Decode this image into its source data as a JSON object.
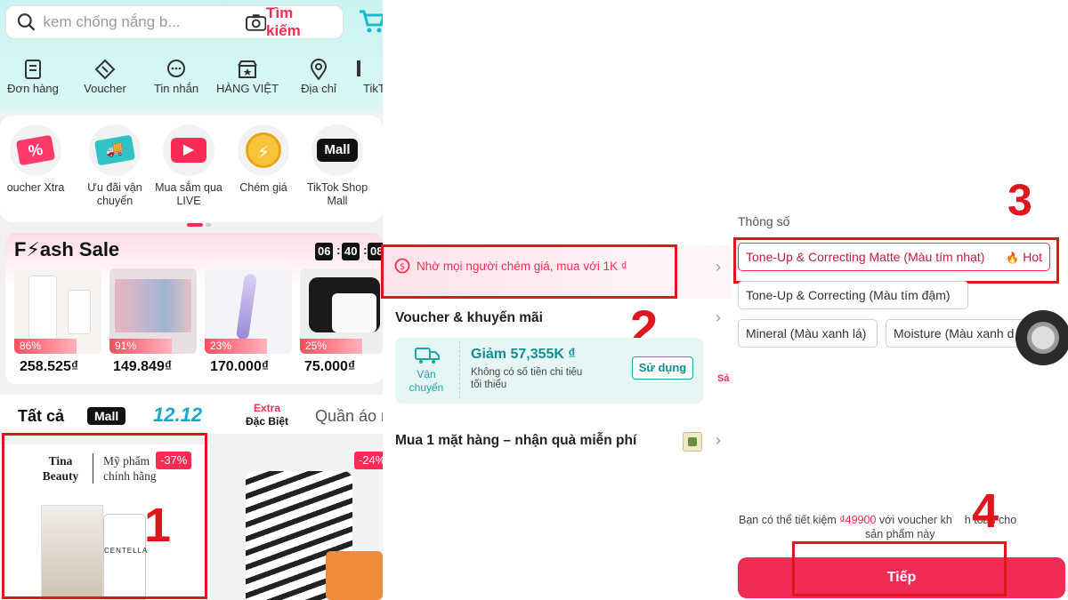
{
  "panel1": {
    "search": {
      "placeholder": "kem chống nắng b...",
      "button": "Tìm kiếm"
    },
    "quick_actions": [
      {
        "label": "Đơn hàng",
        "icon": "orders-icon"
      },
      {
        "label": "Voucher",
        "icon": "ticket-icon"
      },
      {
        "label": "Tin nhắn",
        "icon": "chat-icon"
      },
      {
        "label": "HÀNG VIỆT",
        "icon": "shop-icon"
      },
      {
        "label": "Địa chỉ",
        "icon": "location-icon"
      },
      {
        "label": "TikT",
        "icon": "tiktok-icon"
      }
    ],
    "features": [
      {
        "label": "oucher Xtra",
        "icon": "percent-coupon-icon",
        "glyph": "%"
      },
      {
        "label": "Ưu đãi vận chuyển",
        "icon": "truck-coupon-icon",
        "glyph": "🚚"
      },
      {
        "label": "Mua sắm qua LIVE",
        "icon": "live-video-icon",
        "glyph": "▶"
      },
      {
        "label": "Chém giá",
        "icon": "coin-icon",
        "glyph": "⚡"
      },
      {
        "label": "TikTok Shop Mall",
        "icon": "mall-icon",
        "glyph": "Mall"
      }
    ],
    "flash_sale": {
      "title": "F⚡ash Sale",
      "timer": [
        "06",
        "40",
        "08"
      ],
      "products": [
        {
          "percent": "86%",
          "price": "258.525₫",
          "fill": 0.86
        },
        {
          "percent": "91%",
          "price": "149.849₫",
          "fill": 0.91
        },
        {
          "percent": "23%",
          "price": "170.000₫",
          "fill": 0.23
        },
        {
          "percent": "25%",
          "price": "75.000₫",
          "fill": 0.25
        }
      ]
    },
    "tabs": {
      "all": "Tất cả",
      "mall": "Mall",
      "sale": "12.12",
      "extra1": "Extra",
      "extra2": "Đặc Biệt",
      "clothes": "Quần áo n"
    },
    "product_card_1": {
      "brand": "Tina Beauty",
      "slogan": "Mỹ phẩm chính hãng",
      "discount": "-37%",
      "product_label": "CENTELLA"
    },
    "product_card_2": {
      "discount": "-24%"
    },
    "step": "1"
  },
  "panel2": {
    "bargain_text": "Nhờ mọi người chém giá, mua với 1K ₫",
    "voucher_section": "Voucher & khuyến mãi",
    "voucher": {
      "type_line1": "Vận",
      "type_line2": "chuyển",
      "title": "Giảm 57,355K ₫",
      "desc_line1": "Không có số tiền chi tiêu",
      "desc_line2": "tối thiểu",
      "button": "Sử dụng",
      "side_text": "Sả"
    },
    "gift_text": "Mua 1 mặt hàng – nhận quà miễn phí",
    "step": "2"
  },
  "panel3": {
    "spec_label": "Thông số",
    "options": [
      {
        "label": "Tone-Up & Correcting Matte (Màu tím nhạt)",
        "badge": "Hot",
        "selected": true
      },
      {
        "label": "Tone-Up & Correcting (Màu tím đậm)"
      },
      {
        "label": "Mineral (Màu xanh lá)"
      },
      {
        "label": "Moisture (Màu xanh d"
      }
    ],
    "savings_pre": "Bạn có thể tiết kiệm ",
    "savings_amount": "₫49900",
    "savings_post": " với voucher kh",
    "savings_tail": "h toán cho",
    "savings_line2": "sản phẩm này",
    "next_button": "Tiếp",
    "step3": "3",
    "step4": "4"
  },
  "colors": {
    "accent": "#fe2c55",
    "annotation": "#e0161d",
    "button": "#ef2b56"
  }
}
